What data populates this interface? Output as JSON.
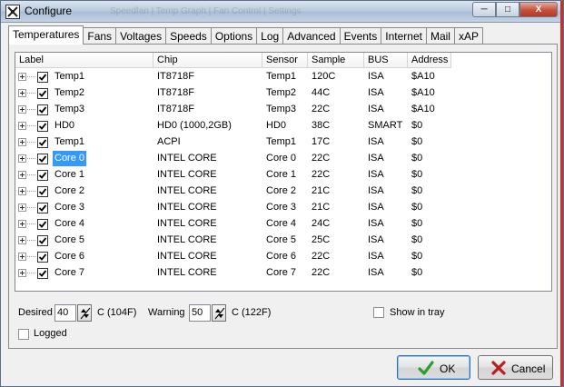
{
  "window": {
    "title": "Configure",
    "background_title": "Speedfan | Temp Graph | Fan Control | Settings",
    "buttons": {
      "minimize": "─",
      "maximize": "□",
      "close": "X"
    }
  },
  "tabs": [
    {
      "label": "Temperatures",
      "active": true
    },
    {
      "label": "Fans"
    },
    {
      "label": "Voltages"
    },
    {
      "label": "Speeds"
    },
    {
      "label": "Options"
    },
    {
      "label": "Log"
    },
    {
      "label": "Advanced"
    },
    {
      "label": "Events"
    },
    {
      "label": "Internet"
    },
    {
      "label": "Mail"
    },
    {
      "label": "xAP"
    }
  ],
  "table": {
    "columns": [
      "Label",
      "Chip",
      "Sensor",
      "Sample",
      "BUS",
      "Address"
    ],
    "rows": [
      {
        "label": "Temp1",
        "chip": "IT8718F",
        "sensor": "Temp1",
        "sample": "120C",
        "bus": "ISA",
        "address": "$A10",
        "checked": true
      },
      {
        "label": "Temp2",
        "chip": "IT8718F",
        "sensor": "Temp2",
        "sample": "44C",
        "bus": "ISA",
        "address": "$A10",
        "checked": true
      },
      {
        "label": "Temp3",
        "chip": "IT8718F",
        "sensor": "Temp3",
        "sample": "22C",
        "bus": "ISA",
        "address": "$A10",
        "checked": true
      },
      {
        "label": "HD0",
        "chip": "HD0 (1000,2GB)",
        "sensor": "HD0",
        "sample": "38C",
        "bus": "SMART",
        "address": "$0",
        "checked": true
      },
      {
        "label": "Temp1",
        "chip": "ACPI",
        "sensor": "Temp1",
        "sample": "17C",
        "bus": "ISA",
        "address": "$0",
        "checked": true
      },
      {
        "label": "Core 0",
        "chip": "INTEL CORE",
        "sensor": "Core 0",
        "sample": "22C",
        "bus": "ISA",
        "address": "$0",
        "checked": true,
        "selected": true
      },
      {
        "label": "Core 1",
        "chip": "INTEL CORE",
        "sensor": "Core 1",
        "sample": "22C",
        "bus": "ISA",
        "address": "$0",
        "checked": true
      },
      {
        "label": "Core 2",
        "chip": "INTEL CORE",
        "sensor": "Core 2",
        "sample": "21C",
        "bus": "ISA",
        "address": "$0",
        "checked": true
      },
      {
        "label": "Core 3",
        "chip": "INTEL CORE",
        "sensor": "Core 3",
        "sample": "21C",
        "bus": "ISA",
        "address": "$0",
        "checked": true
      },
      {
        "label": "Core 4",
        "chip": "INTEL CORE",
        "sensor": "Core 4",
        "sample": "24C",
        "bus": "ISA",
        "address": "$0",
        "checked": true
      },
      {
        "label": "Core 5",
        "chip": "INTEL CORE",
        "sensor": "Core 5",
        "sample": "25C",
        "bus": "ISA",
        "address": "$0",
        "checked": true
      },
      {
        "label": "Core 6",
        "chip": "INTEL CORE",
        "sensor": "Core 6",
        "sample": "22C",
        "bus": "ISA",
        "address": "$0",
        "checked": true
      },
      {
        "label": "Core 7",
        "chip": "INTEL CORE",
        "sensor": "Core 7",
        "sample": "22C",
        "bus": "ISA",
        "address": "$0",
        "checked": true
      }
    ]
  },
  "settings": {
    "desired_label": "Desired",
    "desired_value": "40",
    "desired_unit": "C (104F)",
    "warning_label": "Warning",
    "warning_value": "50",
    "warning_unit": "C (122F)",
    "show_in_tray_label": "Show in tray",
    "show_in_tray_checked": false,
    "logged_label": "Logged",
    "logged_checked": false
  },
  "actions": {
    "ok_label": "OK",
    "cancel_label": "Cancel"
  },
  "colors": {
    "selection": "#3399ff",
    "ok_icon": "#2e9e2e",
    "cancel_icon": "#b52020"
  }
}
